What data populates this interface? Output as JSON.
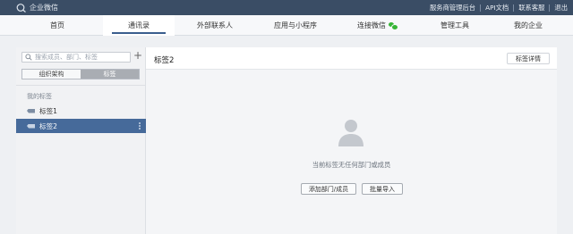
{
  "header": {
    "brand": "企业微信",
    "links": [
      "服务商管理后台",
      "API文档",
      "联系客服",
      "退出"
    ]
  },
  "nav": {
    "items": [
      "首页",
      "通讯录",
      "外部联系人",
      "应用与小程序",
      "连接微信",
      "管理工具",
      "我的企业"
    ],
    "active": "通讯录"
  },
  "sidebar": {
    "search_placeholder": "搜索成员、部门、标签",
    "add_label": "+",
    "tabs": [
      "组织架构",
      "标签"
    ],
    "active_tab": "标签",
    "section_title": "我的标签",
    "tags": [
      "标签1",
      "标签2"
    ],
    "selected_tag": "标签2"
  },
  "main": {
    "title": "标签2",
    "detail_button": "标签详情",
    "empty_text": "当前标签无任何部门或成员",
    "add_button": "添加部门/成员",
    "import_button": "批量导入"
  },
  "colors": {
    "header_bg": "#3a4d65",
    "selected_bg": "#466a9a",
    "wechat_green": "#36b535"
  }
}
